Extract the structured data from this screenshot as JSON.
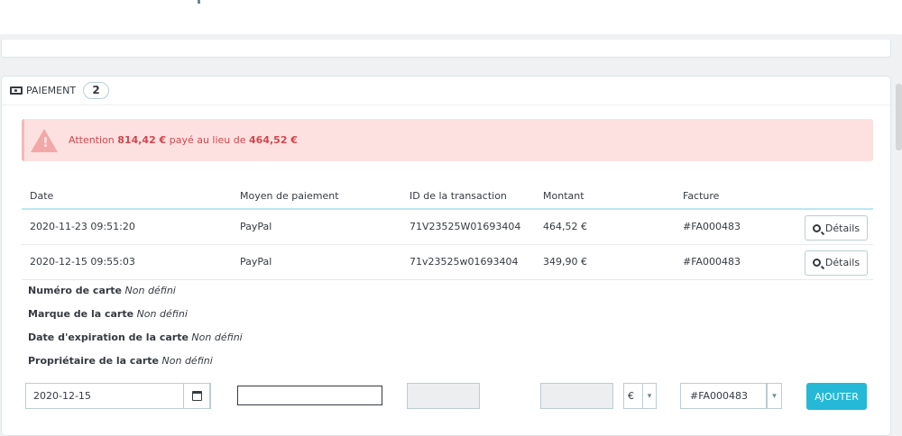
{
  "payment_card": {
    "header_title": "PAIEMENT",
    "count": "2",
    "alert": {
      "prefix": "Attention",
      "paid_amount": "814,42 €",
      "middle": "payé au lieu de",
      "expected_amount": "464,52 €"
    },
    "table": {
      "headers": {
        "date": "Date",
        "method": "Moyen de paiement",
        "transaction": "ID de la transaction",
        "amount": "Montant",
        "invoice": "Facture"
      },
      "rows": [
        {
          "date": "2020-11-23 09:51:20",
          "method": "PayPal",
          "transaction": "71V23525W01693404",
          "amount": "464,52 €",
          "invoice": "#FA000483",
          "details_label": "Détails"
        },
        {
          "date": "2020-12-15 09:55:03",
          "method": "PayPal",
          "transaction": "71v23525w01693404",
          "amount": "349,90 €",
          "invoice": "#FA000483",
          "details_label": "Détails"
        }
      ]
    },
    "card_details": {
      "card_number_label": "Numéro de carte",
      "card_number_value": "Non défini",
      "card_brand_label": "Marque de la carte",
      "card_brand_value": "Non défini",
      "expiry_label": "Date d'expiration de la carte",
      "expiry_value": "Non défini",
      "owner_label": "Propriétaire de la carte",
      "owner_value": "Non défini"
    },
    "form": {
      "date_value": "2020-12-15",
      "method_value": "",
      "transaction_value": "",
      "amount_value": "",
      "currency_value": "€",
      "invoice_value": "#FA000483",
      "add_label": "AJOUTER"
    }
  },
  "icons": {
    "money": "money-icon",
    "warning": "warning-icon",
    "search": "search-icon",
    "calendar": "calendar-icon",
    "chevron": "chevron-down-icon"
  },
  "colors": {
    "accent": "#25b9d7",
    "alert_bg": "#fde1e1",
    "alert_text": "#d0484f"
  }
}
